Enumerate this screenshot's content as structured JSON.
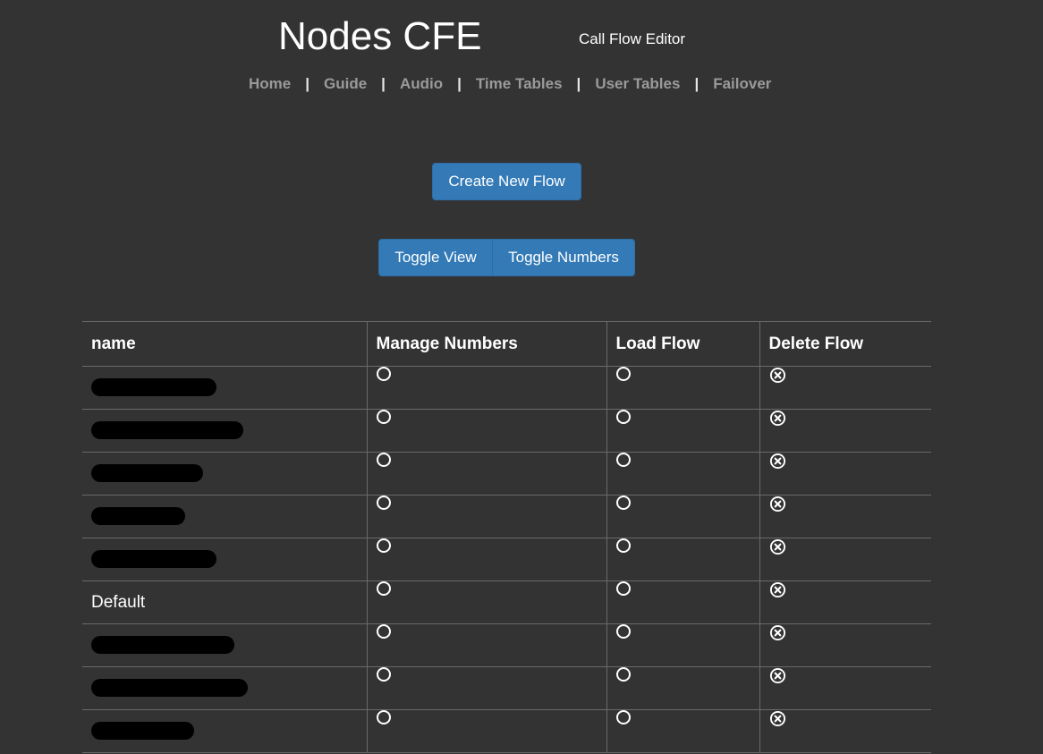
{
  "app": {
    "title": "Nodes CFE",
    "subtitle": "Call Flow Editor"
  },
  "nav": {
    "items": [
      {
        "label": "Home"
      },
      {
        "label": "Guide"
      },
      {
        "label": "Audio"
      },
      {
        "label": "Time Tables"
      },
      {
        "label": "User Tables"
      },
      {
        "label": "Failover"
      }
    ],
    "separator": "|"
  },
  "actions": {
    "create_new_flow": "Create New Flow",
    "toggle_view": "Toggle View",
    "toggle_numbers": "Toggle Numbers"
  },
  "table": {
    "headers": {
      "name": "name",
      "manage_numbers": "Manage Numbers",
      "load_flow": "Load Flow",
      "delete_flow": "Delete Flow"
    },
    "rows": [
      {
        "name": "",
        "redacted": true
      },
      {
        "name": "",
        "redacted": true
      },
      {
        "name": "",
        "redacted": true
      },
      {
        "name": "",
        "redacted": true
      },
      {
        "name": "",
        "redacted": true
      },
      {
        "name": "Default",
        "redacted": false
      },
      {
        "name": "",
        "redacted": true
      },
      {
        "name": "",
        "redacted": true
      },
      {
        "name": "",
        "redacted": true
      }
    ],
    "icons": {
      "manage": "radio-circle-icon",
      "load": "radio-circle-icon",
      "delete": "circle-x-icon"
    }
  },
  "colors": {
    "background": "#333333",
    "accent": "#337ab7",
    "nav_link": "#9a9a9a"
  }
}
